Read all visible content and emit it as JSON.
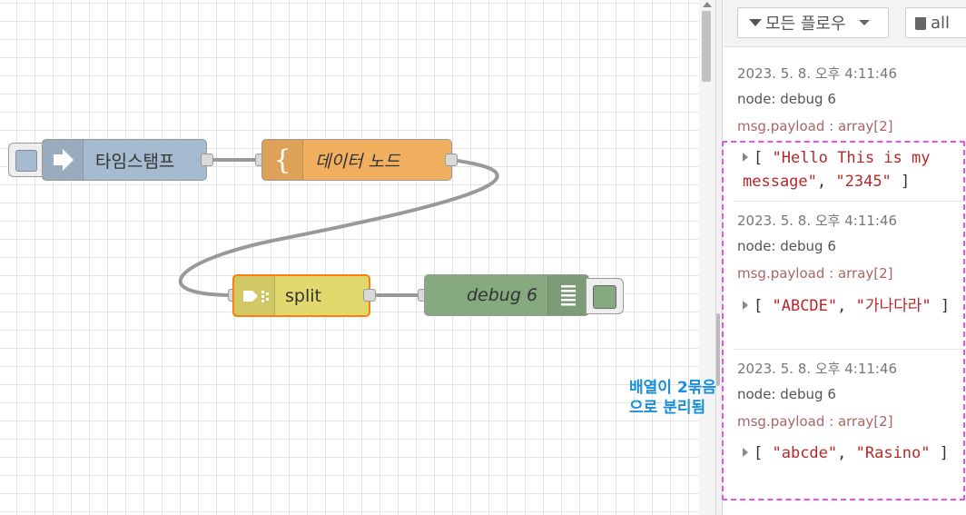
{
  "flow": {
    "nodes": {
      "inject": {
        "label": "타임스탬프"
      },
      "template": {
        "label": "데이터 노드"
      },
      "split": {
        "label": "split"
      },
      "debug": {
        "label": "debug 6"
      }
    }
  },
  "sidebar": {
    "filter_label": "모든 플로우",
    "clear_label": "all",
    "messages": [
      {
        "date": "2023. 5. 8. 오후 4:11:46",
        "node": "node: debug 6",
        "topic": "msg.payload : array[2]",
        "payload_open": "[ ",
        "values": [
          "\"Hello This is my message\"",
          "\"2345\""
        ],
        "payload_close": " ]"
      },
      {
        "date": "2023. 5. 8. 오후 4:11:46",
        "node": "node: debug 6",
        "topic": "msg.payload : array[2]",
        "payload_open": "[ ",
        "values": [
          "\"ABCDE\"",
          "\"가나다라\""
        ],
        "payload_close": " ]"
      },
      {
        "date": "2023. 5. 8. 오후 4:11:46",
        "node": "node: debug 6",
        "topic": "msg.payload : array[2]",
        "payload_open": "[ ",
        "values": [
          "\"abcde\"",
          "\"Rasino\""
        ],
        "payload_close": " ]"
      }
    ]
  },
  "annotation": {
    "line1": "배열이 2묶음",
    "line2": "으로 분리됨"
  },
  "colors": {
    "inject": "#a6bbcf",
    "template": "#f0b060",
    "split": "#e2d96e",
    "split_border": "#ff7f0e",
    "debug": "#87a980",
    "annotation_text": "#1a8fd8",
    "annotation_box": "#f04cf0",
    "string": "#b72828"
  }
}
